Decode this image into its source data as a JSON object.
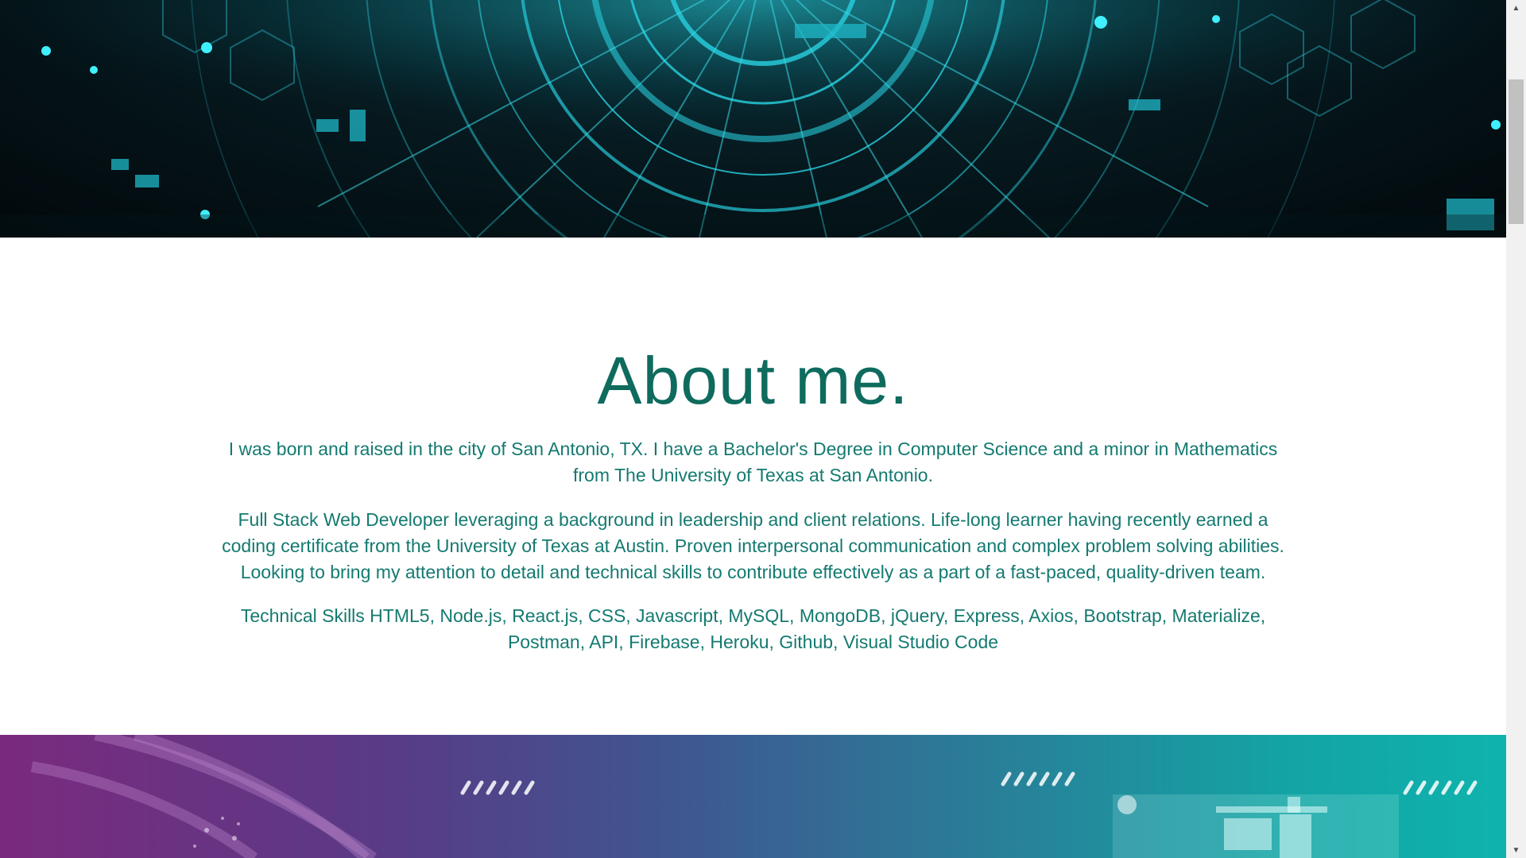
{
  "about": {
    "title": "About me.",
    "paragraph_1": "I was born and raised in the city of San Antonio, TX. I have a Bachelor's Degree in Computer Science and a minor in Mathematics from The University of Texas at San Antonio.",
    "paragraph_2": "Full Stack Web Developer leveraging a background in leadership and client relations. Life-long learner having recently earned a coding certificate from the University of Texas at Austin. Proven interpersonal communication and complex problem solving abilities. Looking to bring my attention to detail and technical skills to contribute effectively as a part of a fast-paced, quality-driven team.",
    "paragraph_3": "Technical Skills HTML5, Node.js, React.js, CSS, Javascript, MySQL, MongoDB, jQuery, Express, Axios, Bootstrap, Materialize, Postman, API, Firebase, Heroku, Github, Visual Studio Code"
  },
  "colors": {
    "title": "#0e6b5e",
    "text": "#147a70",
    "hero_glow": "#1fd3e0",
    "bottom_gradient_start": "#7a2a7e",
    "bottom_gradient_end": "#0fb3ad"
  },
  "icons": {
    "scroll_up": "triangle-up",
    "scroll_down": "triangle-down"
  }
}
